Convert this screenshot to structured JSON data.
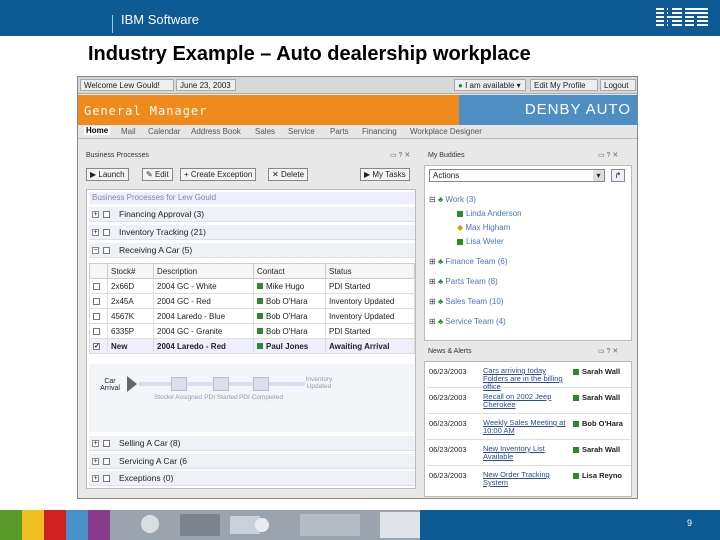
{
  "header": {
    "brand": "IBM Software",
    "logo_text": "IBM"
  },
  "slide": {
    "title": "Industry Example – Auto dealership workplace",
    "page_number": "9"
  },
  "app": {
    "welcome": "Welcome Lew Gould!",
    "date": "June 23, 2003",
    "status": "I am available",
    "edit_profile": "Edit My Profile",
    "logout": "Logout",
    "role_title": "General Manager",
    "company": "DENBY AUTO",
    "nav": [
      "Home",
      "Mail",
      "Calendar",
      "Address Book",
      "Sales",
      "Service",
      "Parts",
      "Financing",
      "Workplace Designer"
    ]
  },
  "business_processes": {
    "header": "Business Processes",
    "buttons": {
      "launch": "Launch",
      "edit": "Edit",
      "create": "Create Exception",
      "delete": "Delete",
      "tasks": "My Tasks"
    },
    "list_title": "Business Processes for Lew Gould",
    "groups_top": [
      {
        "sign": "+",
        "label": "Financing Approval (3)"
      },
      {
        "sign": "+",
        "label": "Inventory Tracking (21)"
      },
      {
        "sign": "−",
        "label": "Receiving A Car (5)"
      }
    ],
    "columns": [
      "Stock#",
      "Description",
      "Contact",
      "Status"
    ],
    "rows": [
      [
        "2x66D",
        "2004 GC - White",
        "Mike Hugo",
        "PDI Started"
      ],
      [
        "2x45A",
        "2004 GC - Red",
        "Bob O'Hara",
        "Inventory Updated"
      ],
      [
        "4567K",
        "2004 Laredo - Blue",
        "Bob O'Hara",
        "Inventory Updated"
      ],
      [
        "6335P",
        "2004 GC - Granite",
        "Bob O'Hara",
        "PDI Started"
      ],
      [
        "New",
        "2004 Laredo - Red",
        "Paul Jones",
        "Awaiting Arrival"
      ]
    ],
    "flow": {
      "start": "Car Arrival",
      "steps": [
        "Stock# Assigned",
        "PDI Started",
        "PDI Completed",
        "Inventory Updated"
      ]
    },
    "groups_bottom": [
      {
        "sign": "+",
        "label": "Selling A Car (8)"
      },
      {
        "sign": "+",
        "label": "Servicing A Car (6"
      },
      {
        "sign": "+",
        "label": "Exceptions (0)"
      }
    ]
  },
  "buddies": {
    "header": "My Buddies",
    "select": "Actions",
    "work": "Work (3)",
    "work_members": [
      "Linda Anderson",
      "Max Higham",
      "Lisa Weler"
    ],
    "teams": [
      "Finance Team (6)",
      "Parts Team (8)",
      "Sales Team (10)",
      "Service Team (4)"
    ]
  },
  "news": {
    "header": "News & Alerts",
    "items": [
      {
        "date": "06/23/2003",
        "text": "Cars arriving today Folders are in the billing office",
        "who": "Sarah Wall"
      },
      {
        "date": "06/23/2003",
        "text": "Recall on 2002 Jeep Cherokee",
        "who": "Sarah Wall"
      },
      {
        "date": "06/23/2003",
        "text": "Weekly Sales Meeting at 10:00 AM",
        "who": "Bob O'Hara"
      },
      {
        "date": "06/23/2003",
        "text": "New Inventory List Available",
        "who": "Sarah Wall"
      },
      {
        "date": "06/23/2003",
        "text": "New Order Tracking System",
        "who": "Lisa Reyno"
      }
    ]
  },
  "colors": {
    "blue": "#0e5a94",
    "orange": "#f08a1c",
    "denby": "#4d8fc4",
    "green": "#2a8a2a"
  }
}
